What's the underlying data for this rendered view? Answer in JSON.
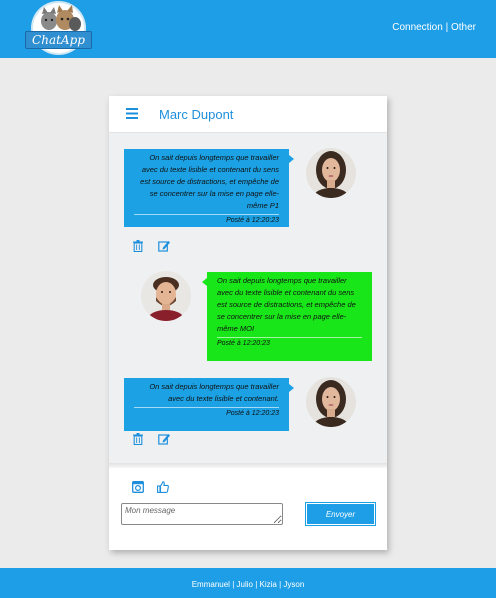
{
  "header": {
    "logo_text": "ChatApp",
    "nav": [
      {
        "label": "Connection"
      },
      {
        "label": "Other"
      }
    ],
    "nav_separator": "|"
  },
  "chat": {
    "contact_name": "Marc Dupont",
    "messages": [
      {
        "side": "right",
        "color": "#1ba1e4",
        "text": "On sait depuis longtemps que travailler avec du texte lisible et contenant du sens est source de distractions, et empêche de se concentrer sur la mise en page elle-même P1",
        "time": "Posté à 12:20:23",
        "avatar": "woman-avatar"
      },
      {
        "side": "left",
        "color": "#19e619",
        "text": "On sait depuis longtemps que travailler avec du texte lisible et contenant du sens est source de distractions, et empêche de se concentrer sur la mise en page elle-même MOI",
        "time": "Posté à 12:20:23",
        "avatar": "man-avatar"
      },
      {
        "side": "right",
        "color": "#1ba1e4",
        "text": "On sait depuis longtemps que travailler avec du texte lisible et contenant.",
        "time": "Posté à 12:20:23",
        "avatar": "woman-avatar"
      }
    ]
  },
  "composer": {
    "placeholder": "Mon message",
    "send_label": "Envoyer"
  },
  "footer": {
    "names": [
      "Emmanuel",
      "Julio",
      "Kizia",
      "Jyson"
    ],
    "separator": "|"
  },
  "colors": {
    "primary": "#1e9ee6",
    "bubble_blue": "#1ba1e4",
    "bubble_green": "#19e619",
    "name_blue": "#1e8fdc"
  }
}
